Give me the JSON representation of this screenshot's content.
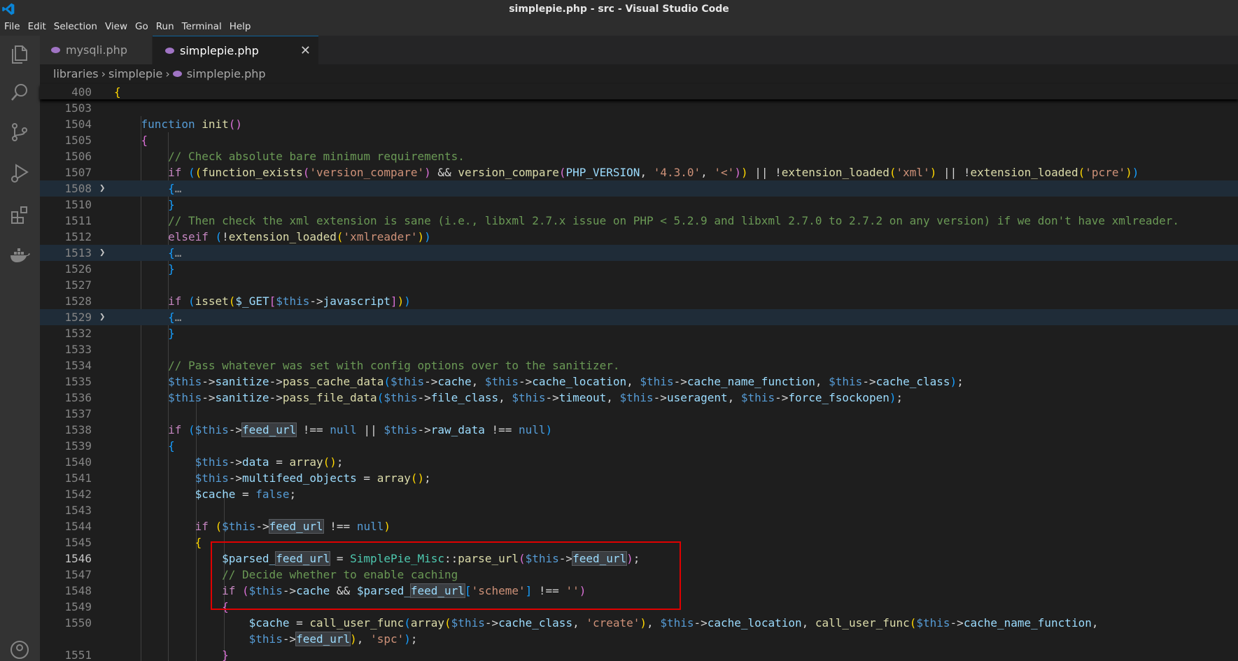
{
  "window": {
    "title": "simplepie.php - src - Visual Studio Code"
  },
  "menu": [
    "File",
    "Edit",
    "Selection",
    "View",
    "Go",
    "Run",
    "Terminal",
    "Help"
  ],
  "activity_icons": [
    "files-icon",
    "search-icon",
    "source-control-icon",
    "run-debug-icon",
    "extensions-icon",
    "docker-icon",
    "account-icon"
  ],
  "tabs": [
    {
      "label": "mysqli.php",
      "active": false
    },
    {
      "label": "simplepie.php",
      "active": true,
      "close": "✕"
    }
  ],
  "breadcrumb": [
    "libraries",
    "simplepie",
    "simplepie.php"
  ],
  "sticky_line": {
    "number": "400",
    "text": "{"
  },
  "lines": [
    {
      "n": "1503"
    },
    {
      "n": "1504"
    },
    {
      "n": "1505"
    },
    {
      "n": "1506"
    },
    {
      "n": "1507"
    },
    {
      "n": "1508"
    },
    {
      "n": "1510"
    },
    {
      "n": "1511"
    },
    {
      "n": "1512"
    },
    {
      "n": "1513"
    },
    {
      "n": "1526"
    },
    {
      "n": "1527"
    },
    {
      "n": "1528"
    },
    {
      "n": "1529"
    },
    {
      "n": "1532"
    },
    {
      "n": "1533"
    },
    {
      "n": "1534"
    },
    {
      "n": "1535"
    },
    {
      "n": "1536"
    },
    {
      "n": "1537"
    },
    {
      "n": "1538"
    },
    {
      "n": "1539"
    },
    {
      "n": "1540"
    },
    {
      "n": "1541"
    },
    {
      "n": "1542"
    },
    {
      "n": "1543"
    },
    {
      "n": "1544"
    },
    {
      "n": "1545"
    },
    {
      "n": "1546"
    },
    {
      "n": "1547"
    },
    {
      "n": "1548"
    },
    {
      "n": "1549"
    },
    {
      "n": "1550"
    },
    {
      "n": ""
    },
    {
      "n": "1551"
    }
  ],
  "code": {
    "l1504": [
      "function",
      "init",
      "()"
    ],
    "l1506": "// Check absolute bare minimum requirements.",
    "l1511": "// Then check the xml extension is sane (i.e., libxml 2.7.x issue on PHP < 5.2.9 and libxml 2.7.0 to 2.7.2 on any version) if we don't have xmlreader.",
    "l1534": "// Pass whatever was set with config options over to the sanitizer.",
    "l1547": "// Decide whether to enable caching",
    "ellipsis": "…"
  },
  "colors": {
    "highlight_box": "#e00000",
    "accent": "#0e639c"
  }
}
